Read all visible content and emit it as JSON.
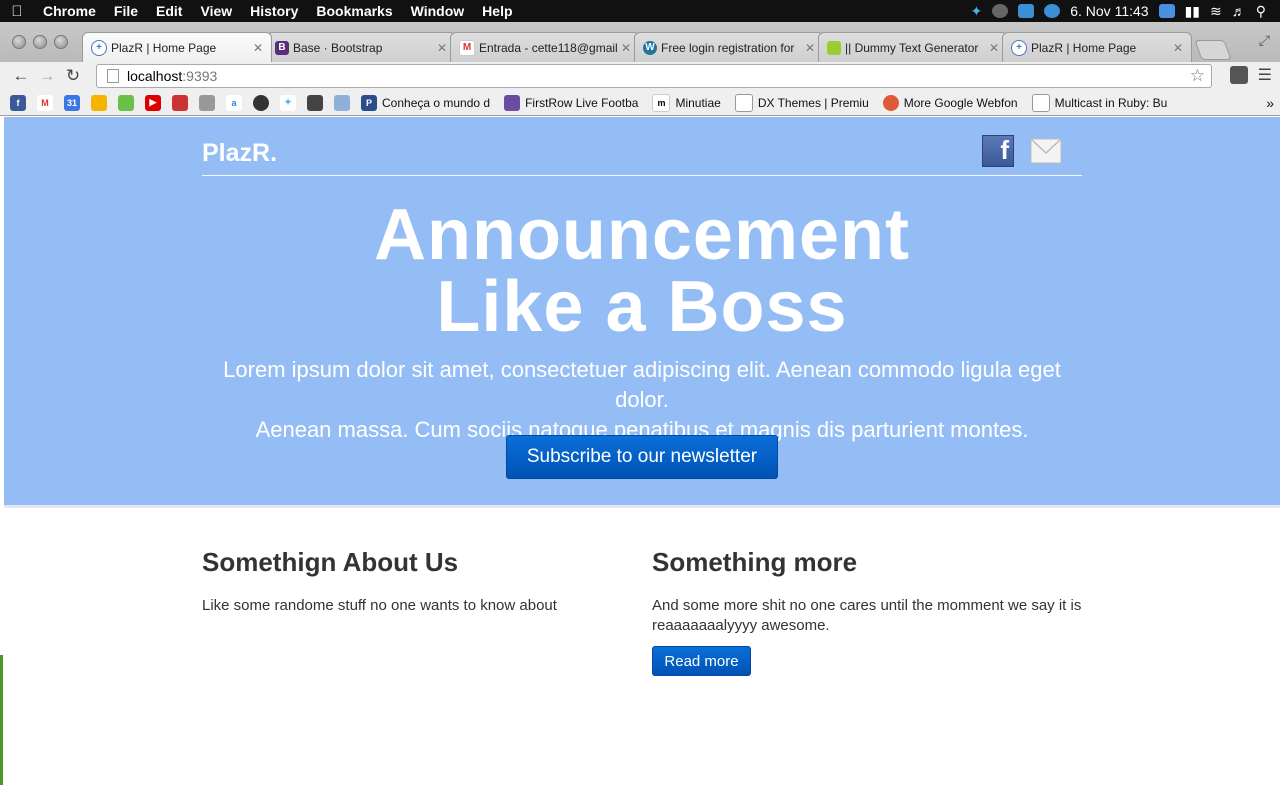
{
  "menubar": {
    "items": [
      "Chrome",
      "File",
      "Edit",
      "View",
      "History",
      "Bookmarks",
      "Window",
      "Help"
    ],
    "clock": "6. Nov  11:43"
  },
  "tabs": [
    {
      "title": "PlazR | Home Page"
    },
    {
      "title": "Base · Bootstrap"
    },
    {
      "title": "Entrada - cette118@gmail"
    },
    {
      "title": "Free login registration for"
    },
    {
      "title": "|| Dummy Text Generator"
    },
    {
      "title": "PlazR | Home Page"
    }
  ],
  "address": {
    "host": "localhost",
    "port": ":9393"
  },
  "bookmarks": [
    "Conheça o mundo d",
    "FirstRow Live Footba",
    "Minutiae",
    "DX Themes | Premiu",
    "More Google Webfon",
    "Multicast in Ruby: Bu"
  ],
  "page": {
    "brand": "PlazR.",
    "headline_line1": "Announcement",
    "headline_line2": "Like a Boss",
    "lead_line1": "Lorem ipsum dolor sit amet, consectetuer adipiscing elit. Aenean commodo ligula eget dolor.",
    "lead_line2": "Aenean massa. Cum sociis natoque penatibus et magnis dis parturient montes.",
    "subscribe_label": "Subscribe to our newsletter",
    "col1": {
      "title": "Somethign About Us",
      "text": "Like some randome stuff no one wants to know about"
    },
    "col2": {
      "title": "Something more",
      "text": "And some more shit no one cares until the momment we say it is reaaaaaaalyyyy awesome.",
      "button": "Read more"
    }
  }
}
